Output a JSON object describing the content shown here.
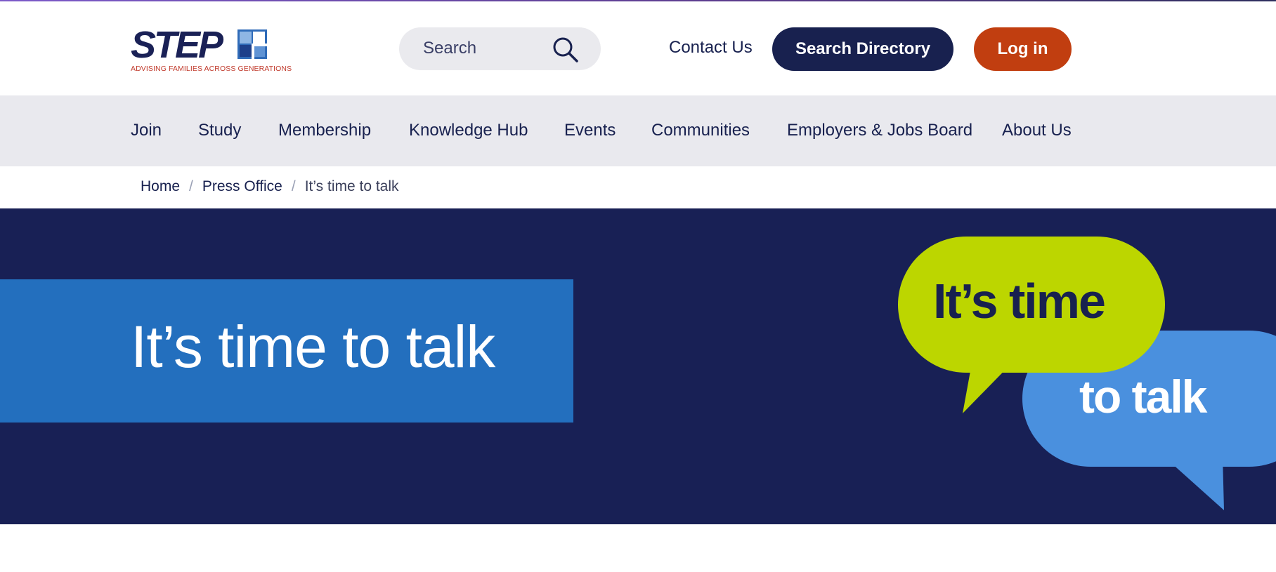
{
  "brand": {
    "name": "STEP",
    "tagline": "ADVISING FAMILIES ACROSS GENERATIONS",
    "colors": {
      "navy": "#18214f",
      "orange": "#c13e10",
      "blue": "#236fbe",
      "lime": "#bcd600",
      "sky": "#4a90de"
    }
  },
  "header": {
    "search_placeholder": "Search",
    "search_icon": "search-icon",
    "contact_label": "Contact Us",
    "directory_label": "Search Directory",
    "login_label": "Log in"
  },
  "nav": {
    "items": [
      {
        "label": "Join"
      },
      {
        "label": "Study"
      },
      {
        "label": "Membership"
      },
      {
        "label": "Knowledge Hub"
      },
      {
        "label": "Events"
      },
      {
        "label": "Communities"
      },
      {
        "label": "Employers & Jobs Board"
      },
      {
        "label": "About Us"
      }
    ]
  },
  "breadcrumb": {
    "items": [
      "Home",
      "Press Office",
      "It’s time to talk"
    ],
    "separator": "/"
  },
  "hero": {
    "title": "It’s time to talk",
    "graphic": {
      "bubble_1": "It’s time",
      "bubble_2": "to talk"
    }
  }
}
